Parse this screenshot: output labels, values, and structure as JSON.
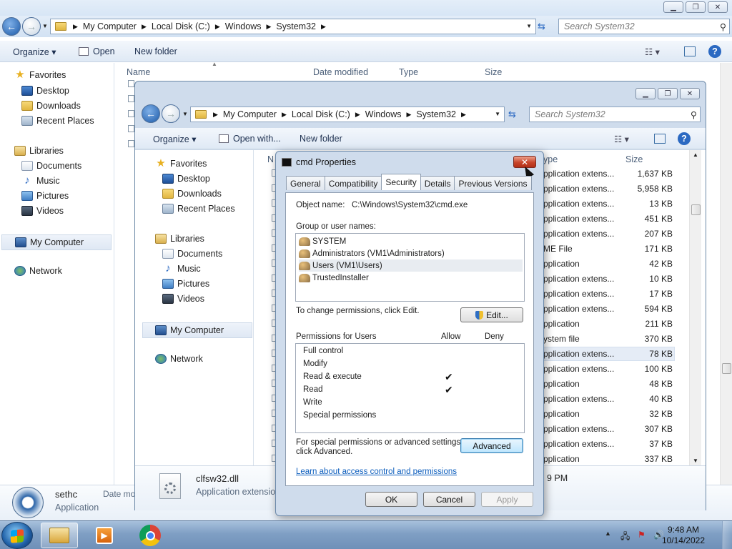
{
  "background_window": {
    "breadcrumbs": [
      "My Computer",
      "Local Disk (C:)",
      "Windows",
      "System32"
    ],
    "search_placeholder": "Search System32",
    "toolbar": {
      "organize": "Organize",
      "open": "Open",
      "new_folder": "New folder"
    },
    "columns": {
      "name": "Name",
      "date_modified": "Date modified",
      "type": "Type",
      "size": "Size"
    },
    "nav": {
      "favorites": "Favorites",
      "desktop": "Desktop",
      "downloads": "Downloads",
      "recent": "Recent Places",
      "libraries": "Libraries",
      "documents": "Documents",
      "music": "Music",
      "pictures": "Pictures",
      "videos": "Videos",
      "computer": "My Computer",
      "network": "Network"
    },
    "details": {
      "name": "sethc",
      "date_label": "Date mo",
      "type": "Application"
    }
  },
  "front_window": {
    "breadcrumbs": [
      "My Computer",
      "Local Disk (C:)",
      "Windows",
      "System32"
    ],
    "search_placeholder": "Search System32",
    "toolbar": {
      "organize": "Organize",
      "open_with": "Open with...",
      "new_folder": "New folder"
    },
    "columns": {
      "name": "N",
      "type": "ype",
      "size": "Size"
    },
    "nav": {
      "favorites": "Favorites",
      "desktop": "Desktop",
      "downloads": "Downloads",
      "recent": "Recent Places",
      "libraries": "Libraries",
      "documents": "Documents",
      "music": "Music",
      "pictures": "Pictures",
      "videos": "Videos",
      "computer": "My Computer",
      "network": "Network"
    },
    "rows": [
      {
        "type": "pplication extens...",
        "size": "1,637 KB"
      },
      {
        "type": "pplication extens...",
        "size": "5,958 KB"
      },
      {
        "type": "pplication extens...",
        "size": "13 KB"
      },
      {
        "type": "pplication extens...",
        "size": "451 KB"
      },
      {
        "type": "pplication extens...",
        "size": "207 KB"
      },
      {
        "type": "ME File",
        "size": "171 KB"
      },
      {
        "type": "pplication",
        "size": "42 KB"
      },
      {
        "type": "pplication extens...",
        "size": "10 KB"
      },
      {
        "type": "pplication extens...",
        "size": "17 KB"
      },
      {
        "type": "pplication extens...",
        "size": "594 KB"
      },
      {
        "type": "pplication",
        "size": "211 KB"
      },
      {
        "type": "ystem file",
        "size": "370 KB"
      },
      {
        "type": "pplication extens...",
        "size": "78 KB"
      },
      {
        "type": "pplication extens...",
        "size": "100 KB"
      },
      {
        "type": "pplication",
        "size": "48 KB"
      },
      {
        "type": "pplication extens...",
        "size": "40 KB"
      },
      {
        "type": "pplication",
        "size": "32 KB"
      },
      {
        "type": "pplication extens...",
        "size": "307 KB"
      },
      {
        "type": "pplication extens...",
        "size": "37 KB"
      },
      {
        "type": "pplication",
        "size": "337 KB"
      }
    ],
    "details": {
      "name": "clfsw32.dll",
      "type": "Application extension",
      "date_tail": "9 PM"
    }
  },
  "dialog": {
    "title": "cmd Properties",
    "tabs": [
      "General",
      "Compatibility",
      "Security",
      "Details",
      "Previous Versions"
    ],
    "active_tab": "Security",
    "object_name_label": "Object name:",
    "object_name_value": "C:\\Windows\\System32\\cmd.exe",
    "group_label": "Group or user names:",
    "users": [
      "SYSTEM",
      "Administrators (VM1\\Administrators)",
      "Users (VM1\\Users)",
      "TrustedInstaller"
    ],
    "selected_user": "Users (VM1\\Users)",
    "change_text": "To change permissions, click Edit.",
    "edit_button": "Edit...",
    "permissions_label": "Permissions for Users",
    "allow_label": "Allow",
    "deny_label": "Deny",
    "permissions": [
      {
        "name": "Full control",
        "allow": false,
        "deny": false
      },
      {
        "name": "Modify",
        "allow": false,
        "deny": false
      },
      {
        "name": "Read & execute",
        "allow": true,
        "deny": false
      },
      {
        "name": "Read",
        "allow": true,
        "deny": false
      },
      {
        "name": "Write",
        "allow": false,
        "deny": false
      },
      {
        "name": "Special permissions",
        "allow": false,
        "deny": false
      }
    ],
    "check_glyph": "✔",
    "advanced_text_1": "For special permissions or advanced settings,",
    "advanced_text_2": "click Advanced.",
    "advanced_button": "Advanced",
    "learn_link": "Learn about access control and permissions",
    "ok_button": "OK",
    "cancel_button": "Cancel",
    "apply_button": "Apply",
    "close_glyph": "✕"
  },
  "taskbar": {
    "time": "9:48 AM",
    "date": "10/14/2022"
  },
  "colors": {
    "accent": "#1c5aa8",
    "link": "#0b5dbd",
    "close_red": "#c8452a"
  }
}
